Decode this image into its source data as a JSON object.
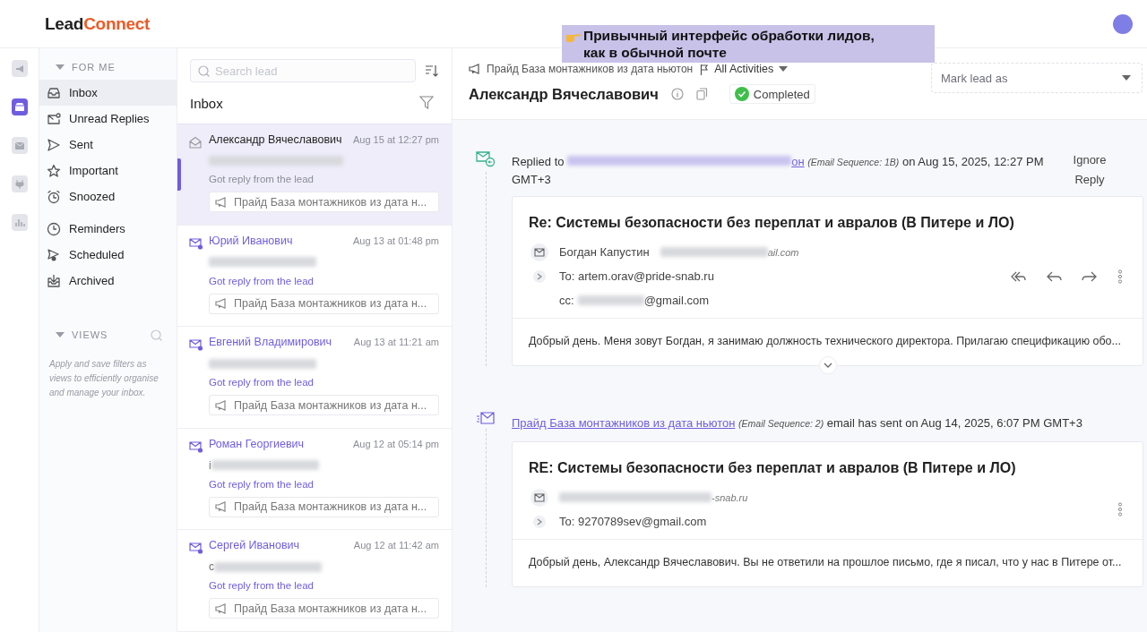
{
  "brand": {
    "first": "Lead",
    "second": "Connect"
  },
  "caption": {
    "text": "Привычный интерфейс обработки лидов, как в обычной почте"
  },
  "rail": [
    {
      "selected": false
    },
    {
      "selected": true
    },
    {
      "selected": false
    },
    {
      "selected": false
    },
    {
      "selected": false
    }
  ],
  "nav": {
    "section": "FOR ME",
    "expanded": true,
    "groups": [
      {
        "items": [
          {
            "label": "Inbox",
            "selected": true
          },
          {
            "label": "Unread Replies",
            "selected": false
          },
          {
            "label": "Sent",
            "selected": false
          },
          {
            "label": "Important",
            "selected": false
          },
          {
            "label": "Snoozed",
            "selected": false
          }
        ]
      },
      {
        "items": [
          {
            "label": "Reminders",
            "selected": false
          },
          {
            "label": "Scheduled",
            "selected": false
          },
          {
            "label": "Archived",
            "selected": false
          }
        ]
      }
    ]
  },
  "views": {
    "title": "VIEWS",
    "expanded": true,
    "hint": "Apply and save filters as views to efficiently organise and manage your inbox."
  },
  "list": {
    "search_placeholder": "Search lead",
    "title": "Inbox",
    "leads": [
      {
        "name": "Александр Вячеславович",
        "time": "Aug 15 at 12:27 pm",
        "status": "Got reply from the lead",
        "campaign": "Прайд База монтажников из дата н...",
        "read": true,
        "selected": true
      },
      {
        "name": "Юрий Иванович",
        "time": "Aug 13 at 01:48 pm",
        "status": "Got reply from the lead",
        "campaign": "Прайд База монтажников из дата н...",
        "read": false,
        "selected": false
      },
      {
        "name": "Евгений Владимирович",
        "time": "Aug 13 at 11:21 am",
        "status": "Got reply from the lead",
        "campaign": "Прайд База монтажников из дата н...",
        "read": false,
        "selected": false
      },
      {
        "name": "Роман Георгиевич",
        "time": "Aug 12 at 05:14 pm",
        "email_visible": "i",
        "status": "Got reply from the lead",
        "campaign": "Прайд База монтажников из дата н...",
        "read": false,
        "selected": false
      },
      {
        "name": "Сергей Иванович",
        "time": "Aug 12 at 11:42 am",
        "email_visible": "c",
        "status": "Got reply from the lead",
        "campaign": "Прайд База монтажников из дата н...",
        "read": false,
        "selected": false
      }
    ]
  },
  "lead_header": {
    "campaign": "Прайд База монтажников из дата ньютон",
    "filter": "All Activities",
    "name": "Александр Вячеславович",
    "status": "Completed",
    "mark_placeholder": "Mark lead as"
  },
  "timeline": [
    {
      "kind": "reply",
      "prefix": "Replied to",
      "link": "он",
      "sequence": "(Email Sequence: 1B)",
      "suffix": "on Aug 15, 2025, 12:27 PM GMT+3",
      "action": "Ignore Reply",
      "email": {
        "subject": "Re: Системы безопасности без переплат и авралов (В Питере и ЛО)",
        "from_name": "Богдан Капустин",
        "from_visible": "ail.com",
        "to": "To: artem.orav@pride-snab.ru",
        "cc_label": "cc:",
        "cc_visible": "@gmail.com",
        "preview": "Добрый день. Меня зовут Богдан, я занимаю должность технического директора. Прилагаю спецификацию обо...",
        "reply_actions": true,
        "expandable": true
      }
    },
    {
      "kind": "sent",
      "link": "Прайд База монтажников из дата ньютон",
      "sequence": "(Email Sequence: 2)",
      "suffix": "email has sent on Aug 14, 2025, 6:07 PM GMT+3",
      "email": {
        "subject": "RE: Системы безопасности без переплат и авралов (В Питере и ЛО)",
        "from_visible": "-snab.ru",
        "to": "To: 9270789sev@gmail.com",
        "preview": "Добрый день, Александр Вячеславович. Вы не ответили на прошлое письмо, где я писал, что у нас в Питере от...",
        "reply_actions": false,
        "expandable": false
      }
    }
  ]
}
